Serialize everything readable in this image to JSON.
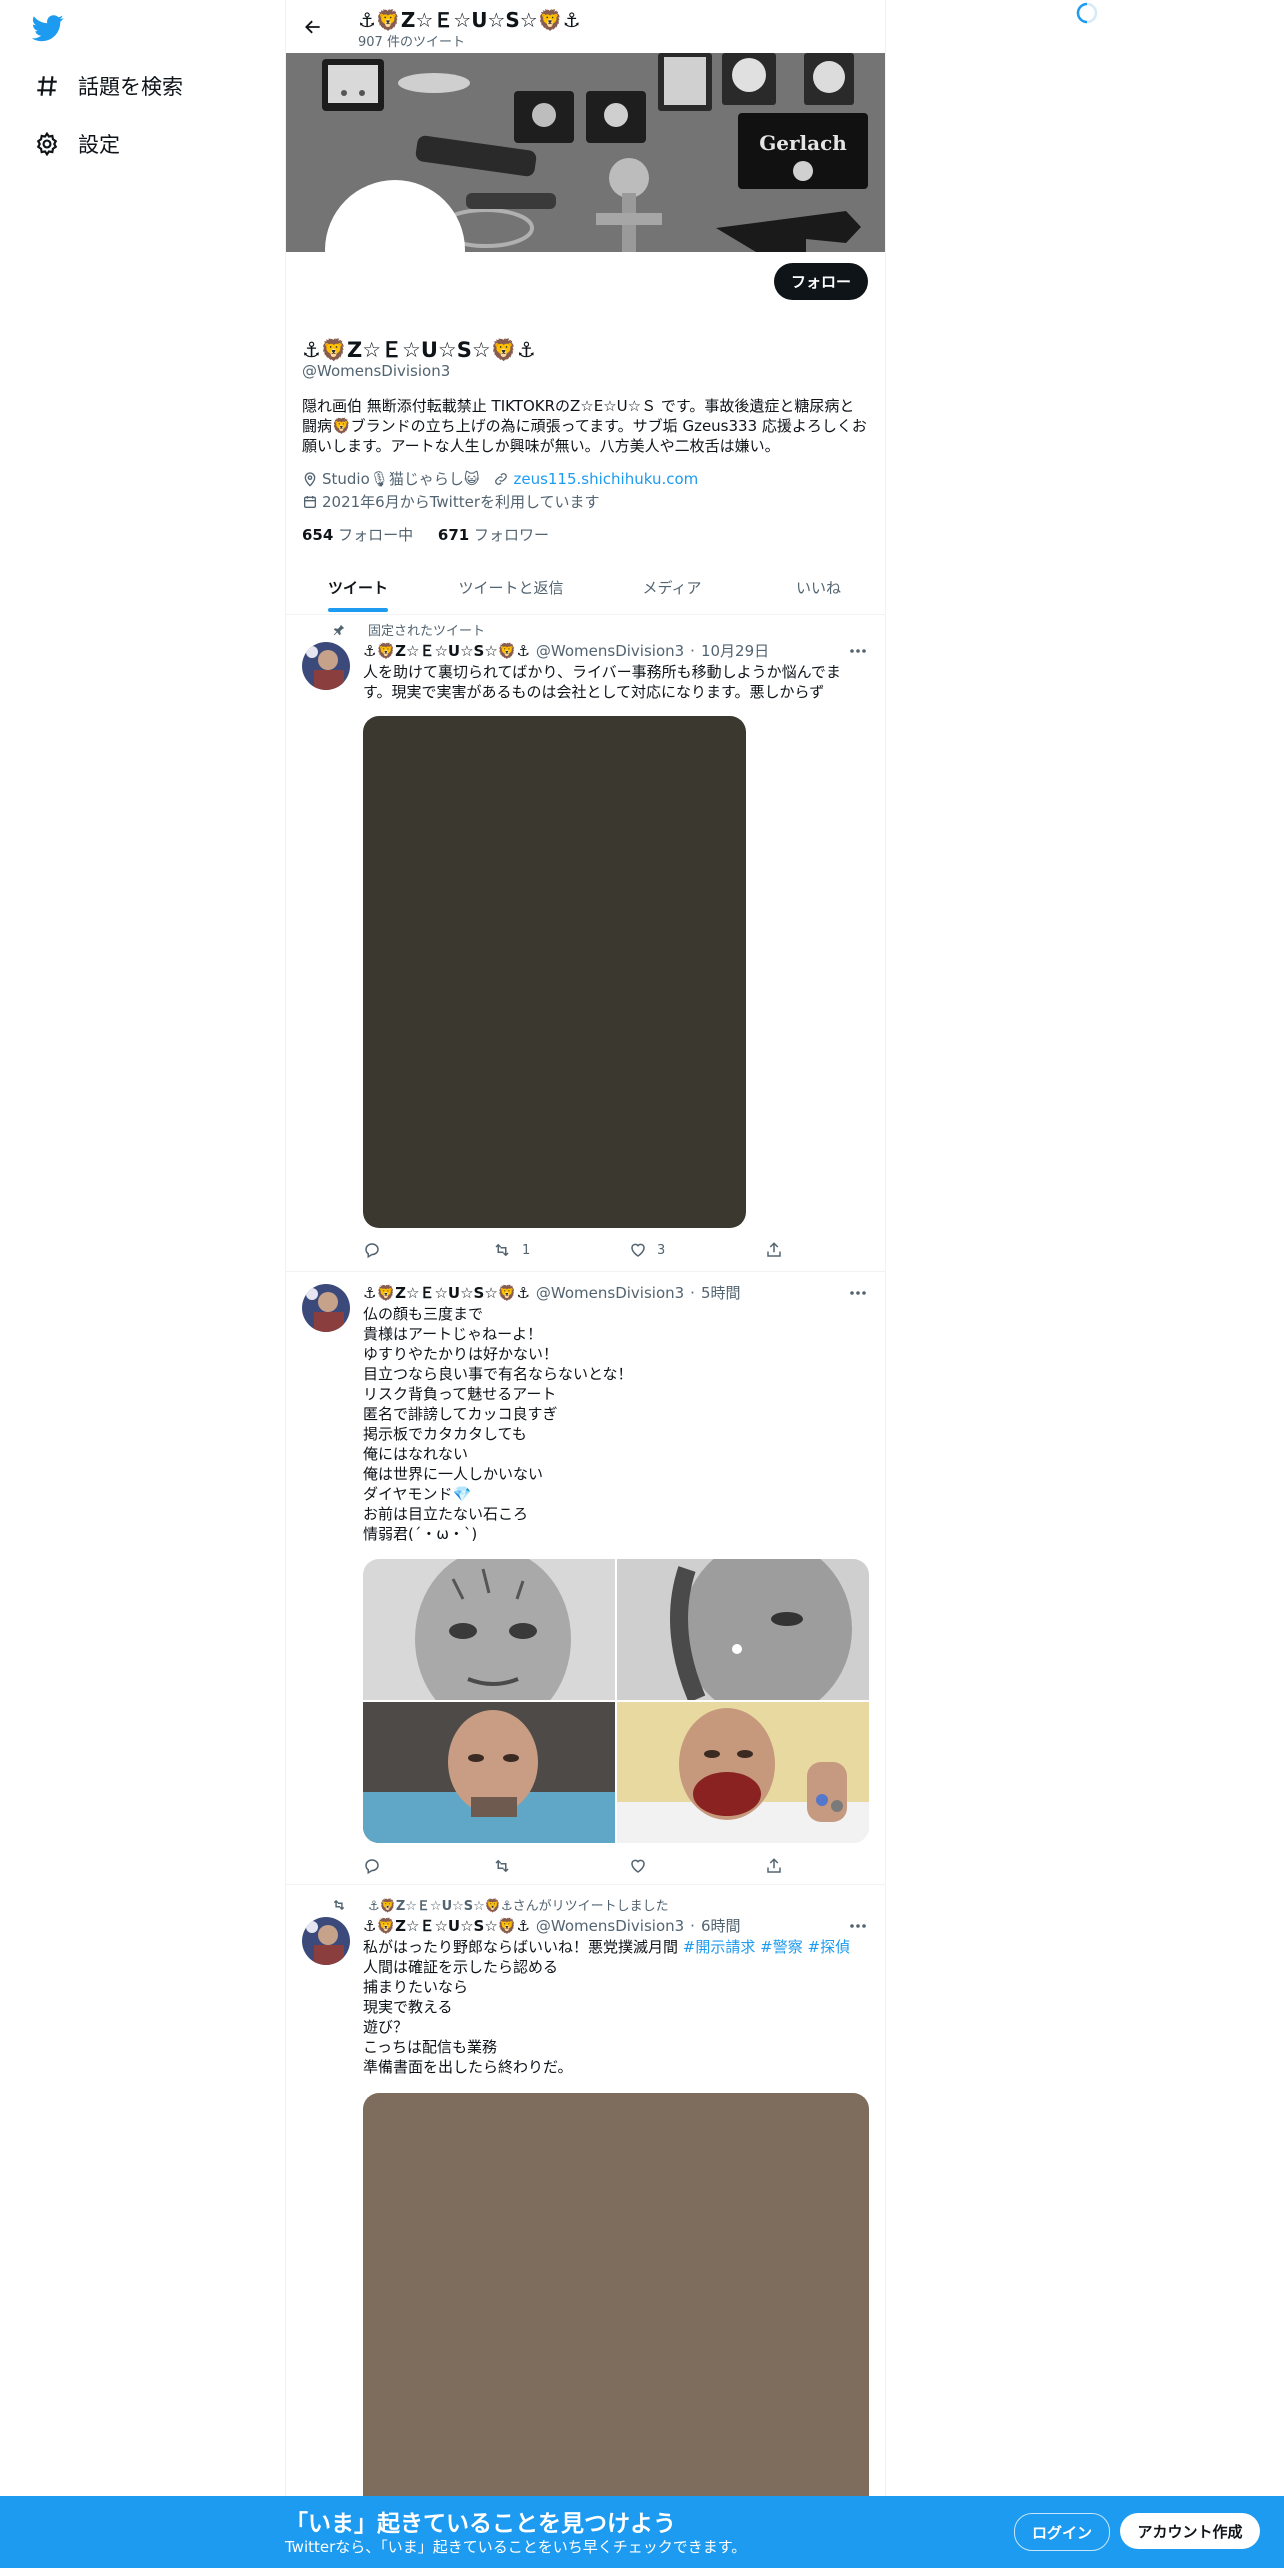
{
  "sidebar": {
    "logo_icon": "twitter-bird-icon",
    "items": [
      {
        "icon": "hashtag-icon",
        "label": "話題を検索"
      },
      {
        "icon": "gear-icon",
        "label": "設定"
      }
    ]
  },
  "header": {
    "name": "⚓🦁Z☆Ｅ☆U☆S☆🦁⚓",
    "tweet_count": "907 件のツイート"
  },
  "banner": {
    "sign_text": "Gerlach"
  },
  "profile": {
    "follow_label": "フォロー",
    "name": "⚓🦁Z☆Ｅ☆U☆S☆🦁⚓",
    "handle": "@WomensDivision3",
    "bio": "隠れ画伯 無断添付転載禁止 TIKTOKRのZ☆E☆U☆Ｓ です。事故後遺症と糖尿病と闘病🦁ブランドの立ち上げの為に頑張ってます。サブ垢 Gzeus333 応援よろしくお願いします。アートな人生しか興味が無い。八方美人や二枚舌は嫌い。",
    "location": "Studio🎙猫じゃらし😺",
    "website": "zeus115.shichihuku.com",
    "joined": "2021年6月からTwitterを利用しています",
    "following_count": "654",
    "following_label": "フォロー中",
    "followers_count": "671",
    "followers_label": "フォロワー"
  },
  "tabs": [
    {
      "label": "ツイート",
      "active": true
    },
    {
      "label": "ツイートと返信",
      "active": false
    },
    {
      "label": "メディア",
      "active": false
    },
    {
      "label": "いいね",
      "active": false
    }
  ],
  "tweets": [
    {
      "context": "固定されたツイート",
      "name": "⚓🦁Z☆Ｅ☆U☆S☆🦁⚓",
      "handle": "@WomensDivision3",
      "time": "10月29日",
      "text": "人を助けて裏切られてばかり、ライバー事務所も移動しようか悩んでます。現実で実害があるものは会社として対応になります。悪しからず",
      "media_color": "#3b3830",
      "replies": "",
      "retweets": "1",
      "likes": "3"
    },
    {
      "name": "⚓🦁Z☆Ｅ☆U☆S☆🦁⚓",
      "handle": "@WomensDivision3",
      "time": "5時間",
      "text": "仏の顔も三度まで\n貴様はアートじゃねーよ！\nゆすりやたかりは好かない！\n目立つなら良い事で有名ならないとな！\nリスク背負って魅せるアート\n匿名で誹謗してカッコ良すぎ\n掲示板でカタカタしても\n俺にはなれない\n俺は世界に一人しかいない\nダイヤモンド💎\nお前は目立たない石ころ\n情弱君(´・ω・`)",
      "retweets": "",
      "likes": ""
    },
    {
      "context_name": "⚓🦁Z☆Ｅ☆U☆S☆🦁⚓",
      "context_suffix": "さんがリツイートしました",
      "name": "⚓🦁Z☆Ｅ☆U☆S☆🦁⚓",
      "handle": "@WomensDivision3",
      "time": "6時間",
      "text_main": "私がはったり野郎ならばいいね！悪党撲滅月間",
      "hashtags": [
        "#開示請求",
        "#警察",
        "#探偵"
      ],
      "text_rest": "人間は確証を示したら認める\n捕まりたいなら\n現実で教える\n遊び？\nこっちは配信も業務\n準備書面を出したら終わりだ。",
      "media_color": "#7e6c5c"
    }
  ],
  "bottom_bar": {
    "title": "「いま」起きていることを見つけよう",
    "subtitle": "Twitterなら、「いま」起きていることをいち早くチェックできます。",
    "login_label": "ログイン",
    "signup_label": "アカウント作成"
  },
  "colors": {
    "accent": "#1d9bf0",
    "text": "#0f1419",
    "muted": "#536471"
  }
}
